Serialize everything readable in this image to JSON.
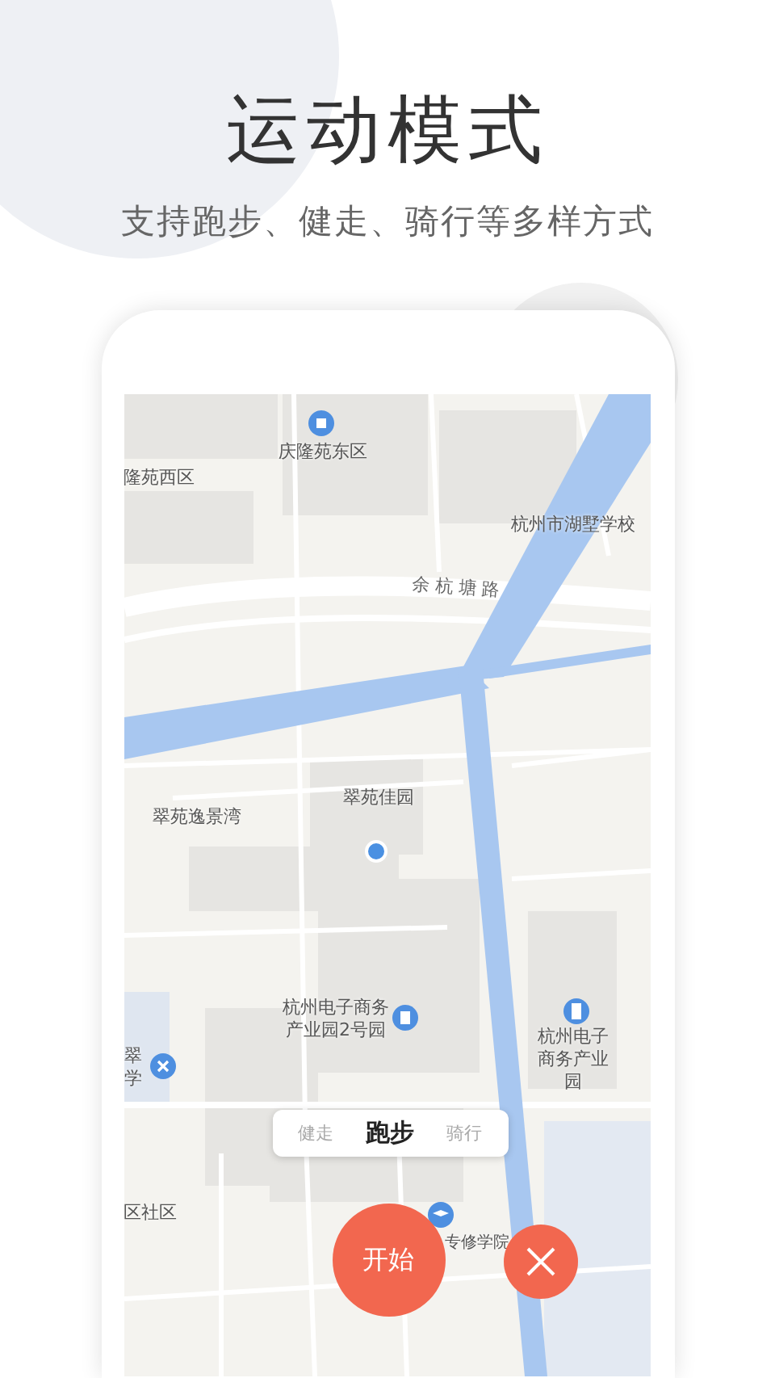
{
  "title": "运动模式",
  "subtitle": "支持跑步、健走、骑行等多样方式",
  "map": {
    "labels": [
      {
        "text": "庆隆苑东区"
      },
      {
        "text": "隆苑西区"
      },
      {
        "text": "杭州市湖墅学校"
      },
      {
        "text": "余 杭 塘 路"
      },
      {
        "text": "翠苑逸景湾"
      },
      {
        "text": "翠苑佳园"
      },
      {
        "text": "杭州电子商务产业园2号园"
      },
      {
        "text": "翠学"
      },
      {
        "text": "杭州电子商务产业园"
      },
      {
        "text": "区社区"
      },
      {
        "text": "专修学院"
      }
    ]
  },
  "modes": [
    {
      "label": "健走",
      "selected": false
    },
    {
      "label": "跑步",
      "selected": true
    },
    {
      "label": "骑行",
      "selected": false
    }
  ],
  "start_button": "开始"
}
